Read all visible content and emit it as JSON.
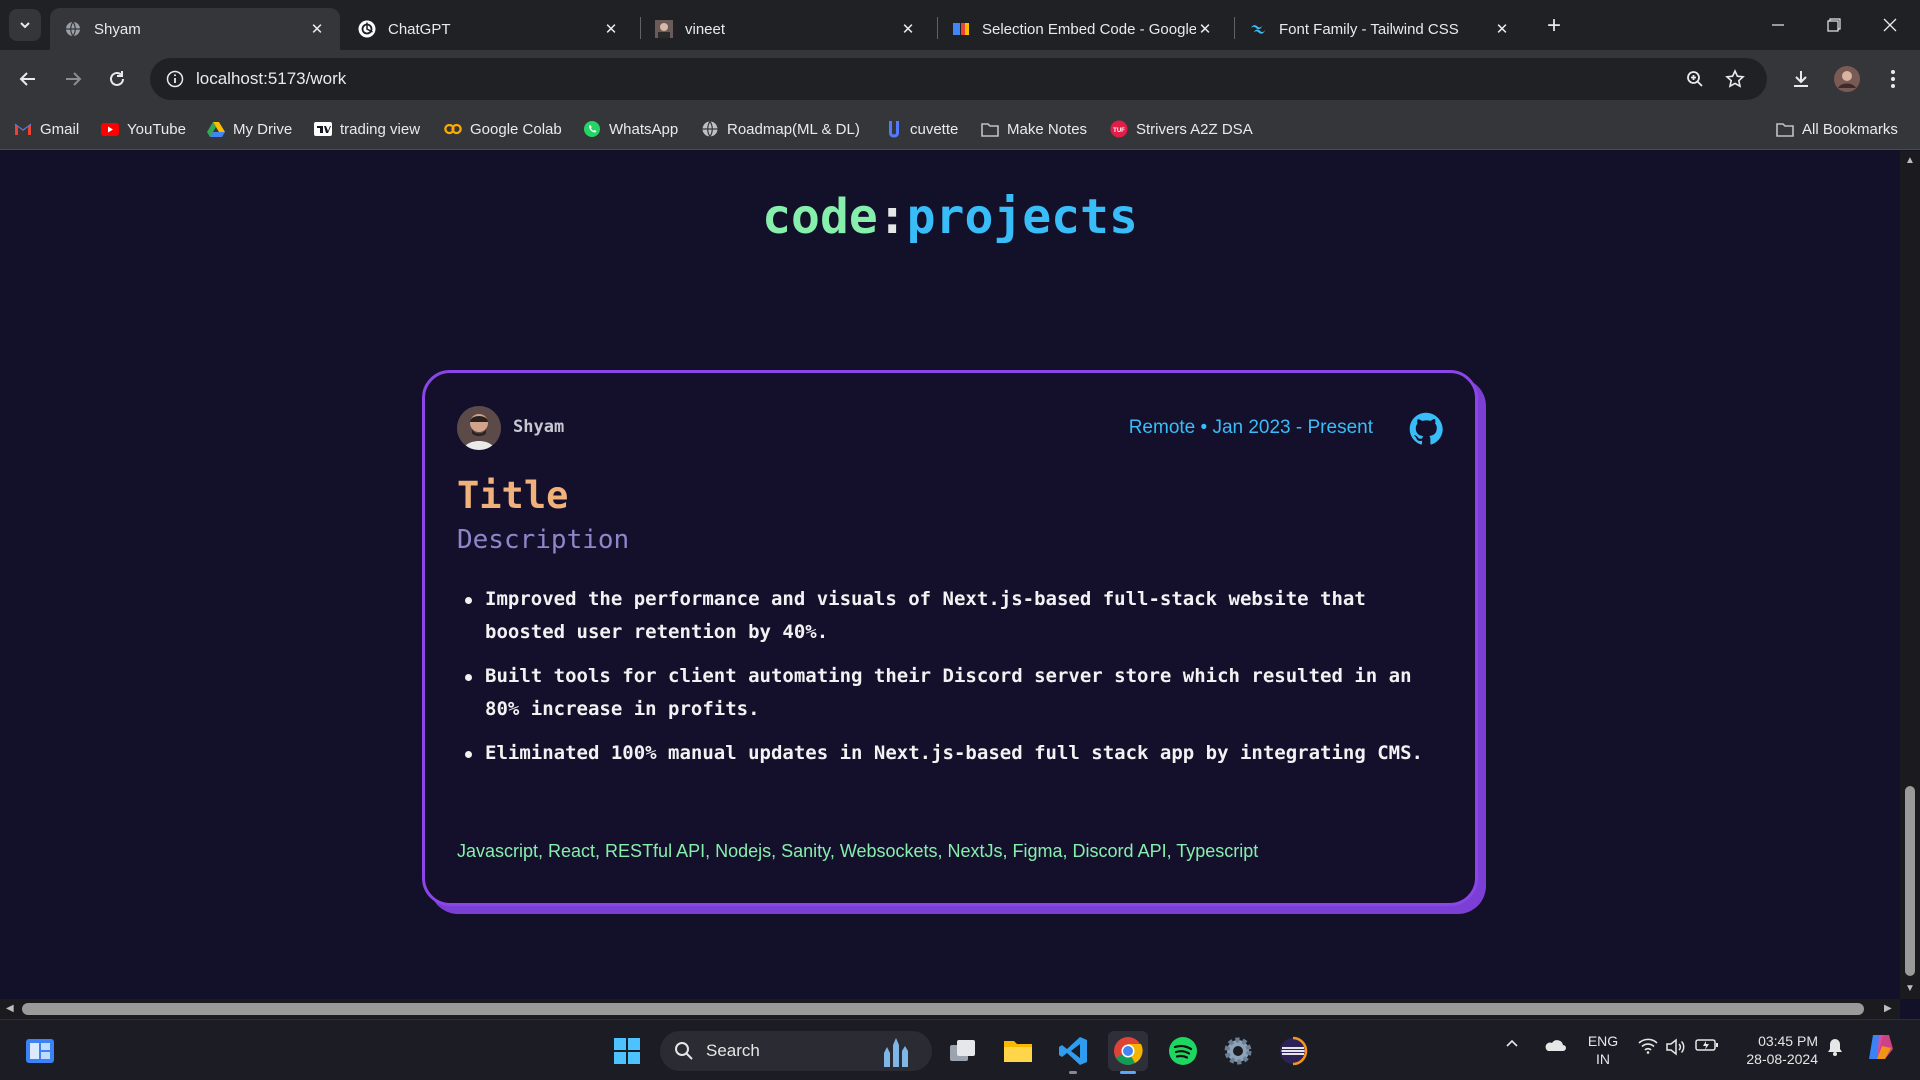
{
  "browser": {
    "tabs": [
      {
        "title": "Shyam",
        "active": true,
        "icon": "globe-icon"
      },
      {
        "title": "ChatGPT",
        "active": false,
        "icon": "chatgpt-icon"
      },
      {
        "title": "vineet",
        "active": false,
        "icon": "avatar-icon"
      },
      {
        "title": "Selection Embed Code - Google",
        "active": false,
        "icon": "google-icon"
      },
      {
        "title": "Font Family - Tailwind CSS",
        "active": false,
        "icon": "tailwind-icon"
      }
    ],
    "url": "localhost:5173/work",
    "bookmarks": [
      {
        "label": "Gmail",
        "icon": "gmail-icon",
        "color": "#ea4335"
      },
      {
        "label": "YouTube",
        "icon": "youtube-icon",
        "color": "#ff0000"
      },
      {
        "label": "My Drive",
        "icon": "drive-icon",
        "color": "#fbbc04"
      },
      {
        "label": "trading view",
        "icon": "tradingview-icon",
        "color": "#ffffff"
      },
      {
        "label": "Google Colab",
        "icon": "colab-icon",
        "color": "#f9ab00"
      },
      {
        "label": "WhatsApp",
        "icon": "whatsapp-icon",
        "color": "#25d366"
      },
      {
        "label": "Roadmap(ML &  DL)",
        "icon": "globe-icon",
        "color": "#bdc1c6"
      },
      {
        "label": "cuvette",
        "icon": "cuvette-icon",
        "color": "#4f7cff"
      },
      {
        "label": "Make Notes",
        "icon": "folder-icon",
        "color": "#bdc1c6"
      },
      {
        "label": "Strivers A2Z DSA",
        "icon": "tuf-icon",
        "color": "#e11d48"
      }
    ],
    "all_bookmarks": "All Bookmarks"
  },
  "page": {
    "heading_part1": "code",
    "heading_colon": ":",
    "heading_part2": "projects",
    "card": {
      "user": "Shyam",
      "meta": "Remote • Jan 2023 - Present",
      "title": "Title",
      "description": "Description",
      "bullets": [
        "Improved the performance and visuals of Next.js-based full-stack website that boosted user retention by 40%.",
        "Built tools for client automating their Discord server store which resulted in an 80% increase in profits.",
        "Eliminated 100% manual updates in Next.js-based full stack app by integrating CMS."
      ],
      "tech": "Javascript, React, RESTful API, Nodejs, Sanity, Websockets, NextJs, Figma, Discord API, Typescript"
    },
    "colors": {
      "green": "#86efac",
      "blue": "#38bdf8",
      "purple": "#8b45e8",
      "orange": "#f0b27a"
    }
  },
  "taskbar": {
    "search_label": "Search",
    "lang_line1": "ENG",
    "lang_line2": "IN",
    "time": "03:45 PM",
    "date": "28-08-2024"
  }
}
